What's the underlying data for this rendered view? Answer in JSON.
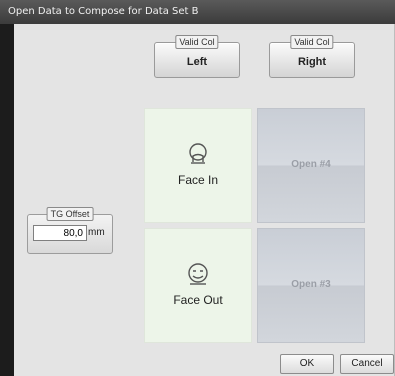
{
  "window": {
    "title": "Open Data to Compose for Data Set B"
  },
  "columns": [
    {
      "tag": "Valid Col",
      "label": "Left"
    },
    {
      "tag": "Valid Col",
      "label": "Right"
    }
  ],
  "slots": {
    "left_top": {
      "label": "Face In",
      "icon": "face-in-icon"
    },
    "left_bottom": {
      "label": "Face Out",
      "icon": "face-out-icon"
    },
    "right_top": {
      "label": "Open #4"
    },
    "right_bottom": {
      "label": "Open #3"
    }
  },
  "tg_offset": {
    "tag": "TG Offset",
    "value": "80,0",
    "unit": "mm"
  },
  "buttons": {
    "ok": "OK",
    "cancel": "Cancel"
  },
  "colors": {
    "title_bar": "#3b3b3b",
    "panel": "#e4e4e4",
    "filled_slot": "#edf5e9",
    "open_slot": "#cfd3d9"
  }
}
